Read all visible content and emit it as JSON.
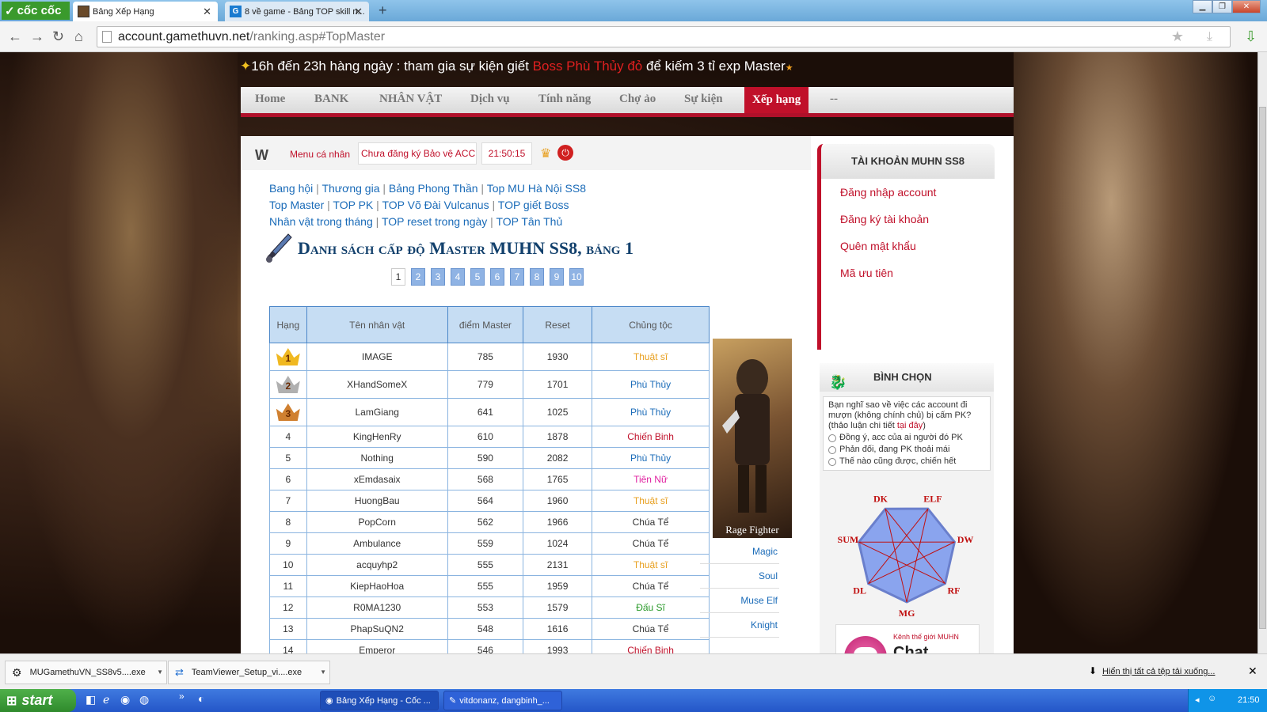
{
  "browser": {
    "brand": "cốc cốc",
    "tabs": [
      {
        "title": "Bảng Xếp Hạng"
      },
      {
        "title": "8 về game - Bảng TOP skill n..."
      }
    ],
    "url_host": "account.gamethuvn.net",
    "url_path": "/ranking.asp#TopMaster"
  },
  "announcement": {
    "part1": "16h đến 23h hàng ngày : tham gia sự kiện giết ",
    "highlight": "Boss Phù Thủy đỏ",
    "part2": " để kiếm 3 tỉ exp Master"
  },
  "topmenu": [
    {
      "label": "Home",
      "active": false
    },
    {
      "label": "BANK",
      "active": false
    },
    {
      "label": "NHÂN VẬT",
      "active": false
    },
    {
      "label": "Dịch vụ",
      "active": false
    },
    {
      "label": "Tính năng",
      "active": false
    },
    {
      "label": "Chợ ảo",
      "active": false
    },
    {
      "label": "Sự kiện",
      "active": false
    },
    {
      "label": "Xếp hạng",
      "active": true
    },
    {
      "label": "--",
      "active": false
    }
  ],
  "subbar": {
    "logo": "W",
    "menu_label": "Menu cá nhân",
    "account_status": "Chưa đăng ký Bảo vệ ACC",
    "clock": "21:50:15"
  },
  "ranking_links": [
    [
      "Bang hội",
      "Thương gia",
      "Bảng Phong Thần",
      "Top MU Hà Nội SS8"
    ],
    [
      "Top Master",
      "TOP PK",
      "TOP Võ Đài Vulcanus",
      "TOP giết Boss"
    ],
    [
      "Nhân vật trong tháng",
      "TOP reset trong ngày",
      "TOP Tân Thủ"
    ]
  ],
  "list_title": "Danh sách cấp độ Master MUHN SS8, bảng 1",
  "pages": [
    "1",
    "2",
    "3",
    "4",
    "5",
    "6",
    "7",
    "8",
    "9",
    "10"
  ],
  "current_page": "1",
  "table": {
    "headers": [
      "Hạng",
      "Tên nhân vật",
      "điểm Master",
      "Reset",
      "Chủng tộc"
    ],
    "rows": [
      {
        "rank": "1",
        "name": "IMAGE",
        "master": "785",
        "reset": "1930",
        "race": "Thuật sĩ",
        "color": "#e8a020"
      },
      {
        "rank": "2",
        "name": "XHandSomeX",
        "master": "779",
        "reset": "1701",
        "race": "Phù Thủy",
        "color": "#1a6bb8"
      },
      {
        "rank": "3",
        "name": "LamGiang",
        "master": "641",
        "reset": "1025",
        "race": "Phù Thủy",
        "color": "#1a6bb8"
      },
      {
        "rank": "4",
        "name": "KingHenRy",
        "master": "610",
        "reset": "1878",
        "race": "Chiến Binh",
        "color": "#c0102a"
      },
      {
        "rank": "5",
        "name": "Nothing",
        "master": "590",
        "reset": "2082",
        "race": "Phù Thủy",
        "color": "#1a6bb8"
      },
      {
        "rank": "6",
        "name": "xEmdasaix",
        "master": "568",
        "reset": "1765",
        "race": "Tiên Nữ",
        "color": "#e020a0"
      },
      {
        "rank": "7",
        "name": "HuongBau",
        "master": "564",
        "reset": "1960",
        "race": "Thuật sĩ",
        "color": "#e8a020"
      },
      {
        "rank": "8",
        "name": "PopCorn",
        "master": "562",
        "reset": "1966",
        "race": "Chúa Tể",
        "color": "#333333"
      },
      {
        "rank": "9",
        "name": "Ambulance",
        "master": "559",
        "reset": "1024",
        "race": "Chúa Tể",
        "color": "#333333"
      },
      {
        "rank": "10",
        "name": "acquyhp2",
        "master": "555",
        "reset": "2131",
        "race": "Thuật sĩ",
        "color": "#e8a020"
      },
      {
        "rank": "11",
        "name": "KiepHaoHoa",
        "master": "555",
        "reset": "1959",
        "race": "Chúa Tể",
        "color": "#333333"
      },
      {
        "rank": "12",
        "name": "R0MA1230",
        "master": "553",
        "reset": "1579",
        "race": "Đấu Sĩ",
        "color": "#2a9a2a"
      },
      {
        "rank": "13",
        "name": "PhapSuQN2",
        "master": "548",
        "reset": "1616",
        "race": "Chúa Tể",
        "color": "#333333"
      },
      {
        "rank": "14",
        "name": "Emperor",
        "master": "546",
        "reset": "1993",
        "race": "Chiến Binh",
        "color": "#c0102a"
      }
    ]
  },
  "class_panel": {
    "image_caption": "Rage Fighter",
    "links": [
      "Magic",
      "Soul",
      "Muse Elf",
      "Knight"
    ]
  },
  "account_box": {
    "title": "TÀI KHOẢN MUHN SS8",
    "links": [
      "Đăng nhập account",
      "Đăng ký tài khoản",
      "Quên mật khẩu",
      "Mã ưu tiên"
    ]
  },
  "poll": {
    "title": "BÌNH CHỌN",
    "question": "Bạn nghĩ sao về việc các account đi mượn (không chính chủ) bị cấm PK? (thảo luận chi tiết ",
    "question_link": "tại đây",
    "question_end": ")",
    "options": [
      "Đồng ý, acc của ai người đó PK",
      "Phản đối, đang PK thoải mái",
      "Thế nào cũng được, chiến hết"
    ]
  },
  "class_diagram_labels": [
    "DK",
    "ELF",
    "DW",
    "RF",
    "MG",
    "DL",
    "SUM"
  ],
  "chat_banner": {
    "small": "Kênh thế giới MUHN",
    "big": "Chat Server"
  },
  "downloads": {
    "items": [
      "MUGamethuVN_SS8v5....exe",
      "TeamViewer_Setup_vi....exe"
    ],
    "show_all": "Hiển thị tất cả tệp tải xuống..."
  },
  "taskbar": {
    "start": "start",
    "tasks": [
      "Bảng Xếp Hạng - Cốc ...",
      "vitdonanz, dangbinh_..."
    ],
    "clock": "21:50"
  }
}
